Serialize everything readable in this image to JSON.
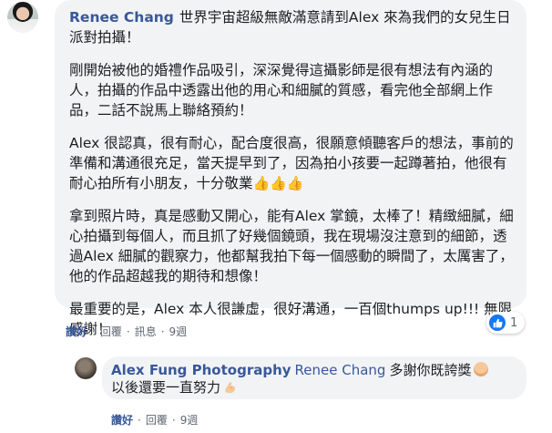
{
  "main_comment": {
    "author": "Renee Chang",
    "paragraphs": [
      "世界宇宙超級無敵滿意請到Alex 來為我們的女兒生日派對拍攝！",
      "剛開始被他的婚禮作品吸引，深深覺得這攝影師是很有想法有內涵的人，拍攝的作品中透露出他的用心和細膩的質感，看完他全部網上作品，二話不說馬上聯絡預約！",
      "Alex 很認真，很有耐心，配合度很高，很願意傾聽客戶的想法，事前的準備和溝通很充足，當天提早到了，因為拍小孩要一起蹲著拍，他很有耐心拍所有小朋友，十分敬業",
      "拿到照片時，真是感動又開心，能有Alex 掌鏡，太棒了！精緻細膩，細心拍攝到每個人，而且抓了好幾個鏡頭，我在現場沒注意到的細節，透過Alex 細膩的觀察力，他都幫我拍下每一個感動的瞬間了，太厲害了，他的作品超越我的期待和想像！",
      "最重要的是，Alex 本人很謙虛，很好溝通，一百個thumps up!!! 無限感謝！"
    ],
    "thumbs_emoji": "👍👍👍",
    "reaction_count": "1",
    "actions": {
      "like": "讚好",
      "reply": "回覆",
      "message": "訊息",
      "time": "9週"
    }
  },
  "reply": {
    "author": "Alex Fung Photography",
    "mention": "Renee Chang",
    "text_line1": "多謝你既誇獎",
    "text_line2": "以後還要一直努力",
    "actions": {
      "like": "讚好",
      "reply": "回覆",
      "time": "9週"
    }
  },
  "colors": {
    "link": "#385898",
    "bubble": "#f2f3f5",
    "like_blue": "#1877f2",
    "meta_gray": "#606770"
  }
}
